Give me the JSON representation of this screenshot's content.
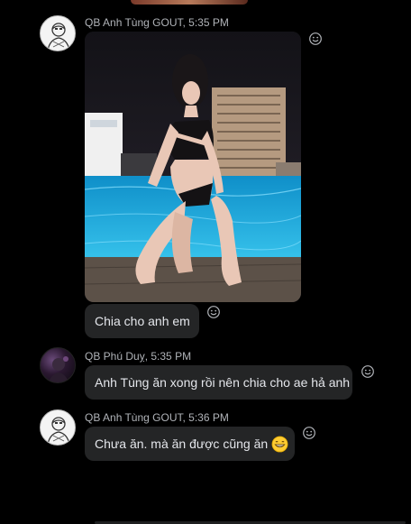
{
  "messages": [
    {
      "sender": "QB Anh Tùng GOUT",
      "sep": ", ",
      "time": "5:35 PM",
      "avatar": "sketch-avatar",
      "photo": "swimsuit-photo",
      "text": "Chia cho anh em"
    },
    {
      "sender": "QB Phú Duỵ",
      "sep": ", ",
      "time": "5:35 PM",
      "avatar": "dark-avatar",
      "text": "Anh Tùng ăn xong rồi nên chia cho ae hả anh"
    },
    {
      "sender": "QB Anh Tùng GOUT",
      "sep": ", ",
      "time": "5:36 PM",
      "avatar": "sketch-avatar",
      "text": "Chưa ăn. mà ăn được cũng ăn",
      "emoji": "grinning-face-emoji"
    }
  ],
  "icons": {
    "reaction": "smiley-reaction-icon"
  },
  "colors": {
    "background": "#000000",
    "bubble": "#242526",
    "text": "#e4e6eb",
    "meta": "#b0b3b8"
  }
}
